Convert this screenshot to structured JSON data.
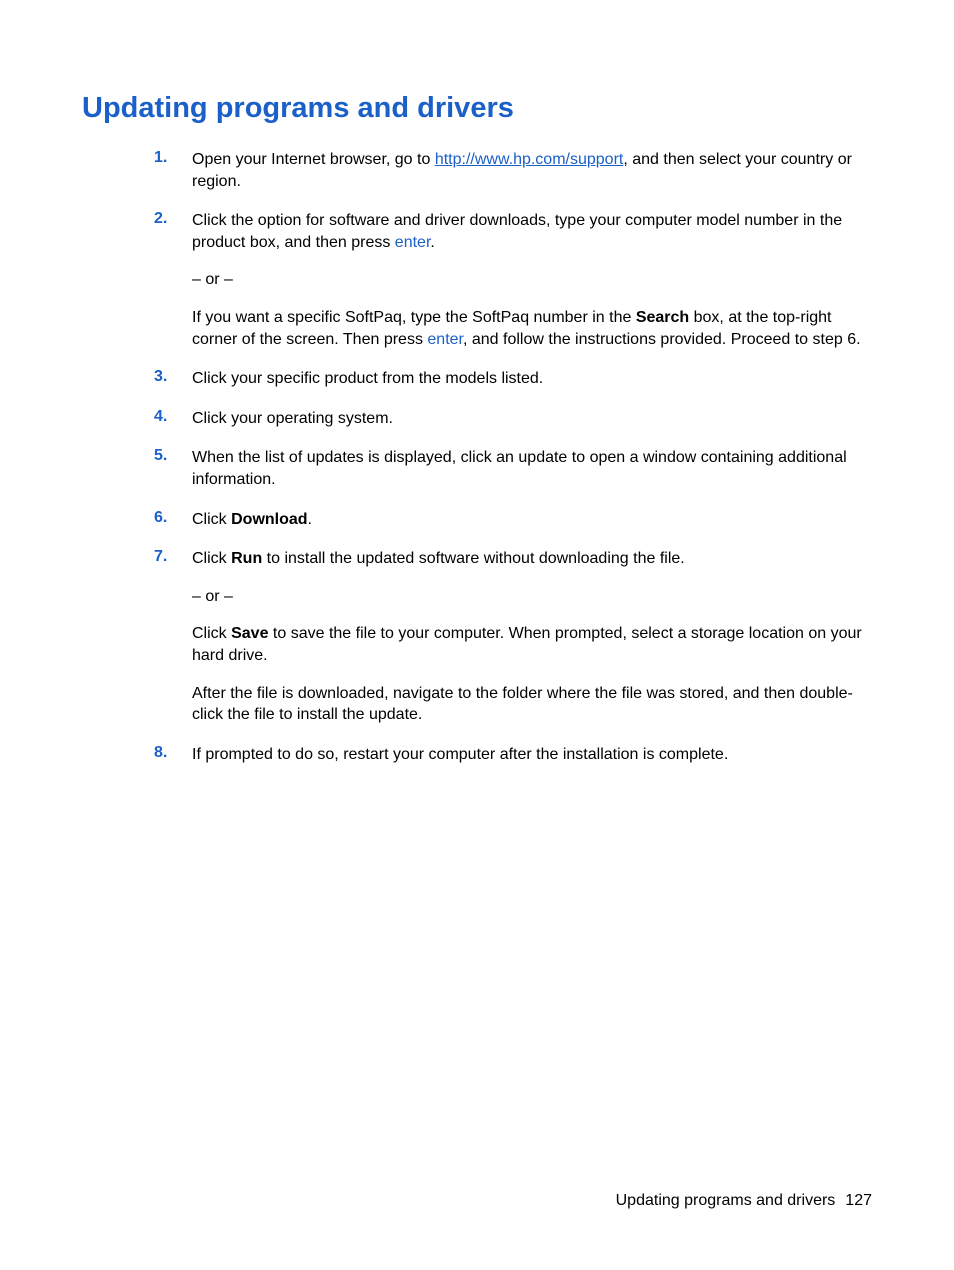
{
  "heading": "Updating programs and drivers",
  "steps": {
    "n1": "1.",
    "s1_a": "Open your Internet browser, go to ",
    "s1_link": "http://www.hp.com/support",
    "s1_b": ", and then select your country or region.",
    "n2": "2.",
    "s2_a": "Click the option for software and driver downloads, type your computer model number in the product box, and then press ",
    "s2_enter": "enter",
    "s2_b": ".",
    "s2_or": "– or –",
    "s2_c": "If you want a specific SoftPaq, type the SoftPaq number in the ",
    "s2_search": "Search",
    "s2_d": " box, at the top-right corner of the screen. Then press ",
    "s2_enter2": "enter",
    "s2_e": ", and follow the instructions provided. Proceed to step 6.",
    "n3": "3.",
    "s3": "Click your specific product from the models listed.",
    "n4": "4.",
    "s4": "Click your operating system.",
    "n5": "5.",
    "s5": "When the list of updates is displayed, click an update to open a window containing additional information.",
    "n6": "6.",
    "s6_a": "Click ",
    "s6_download": "Download",
    "s6_b": ".",
    "n7": "7.",
    "s7_a": "Click ",
    "s7_run": "Run",
    "s7_b": " to install the updated software without downloading the file.",
    "s7_or": "– or –",
    "s7_c": "Click ",
    "s7_save": "Save",
    "s7_d": " to save the file to your computer. When prompted, select a storage location on your hard drive.",
    "s7_e": "After the file is downloaded, navigate to the folder where the file was stored, and then double-click the file to install the update.",
    "n8": "8.",
    "s8": "If prompted to do so, restart your computer after the installation is complete."
  },
  "footer": {
    "text": "Updating programs and drivers",
    "page": "127"
  }
}
